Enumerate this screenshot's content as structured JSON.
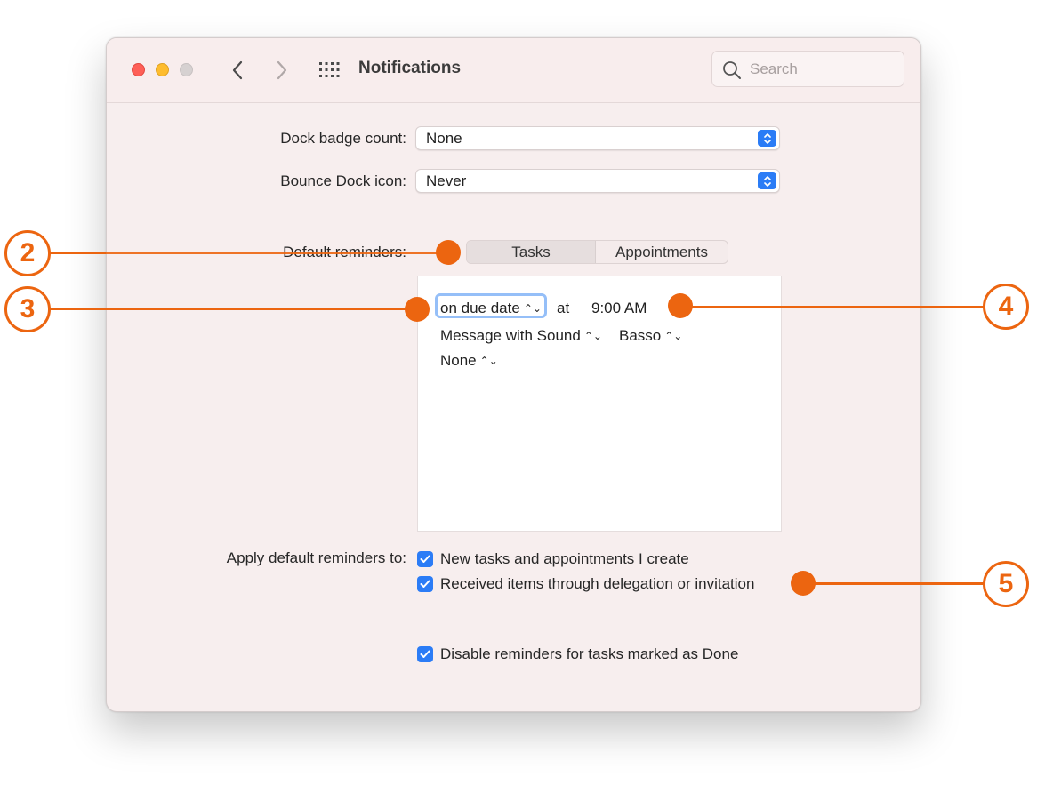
{
  "window": {
    "title": "Notifications",
    "search_placeholder": "Search"
  },
  "dock_badge": {
    "label": "Dock badge count:",
    "value": "None"
  },
  "bounce_dock": {
    "label": "Bounce Dock icon:",
    "value": "Never"
  },
  "default_reminders": {
    "label": "Default reminders:",
    "tabs": [
      "Tasks",
      "Appointments"
    ],
    "selected_tab": "Tasks",
    "when": "on due date",
    "at_label": "at",
    "time": "9:00 AM",
    "alert_type": "Message with Sound",
    "sound": "Basso",
    "extra": "None"
  },
  "apply_to": {
    "label": "Apply default reminders to:",
    "options": [
      {
        "label": "New tasks and appointments I create",
        "checked": true
      },
      {
        "label": "Received items through delegation or invitation",
        "checked": true
      }
    ]
  },
  "disable_done": {
    "label": "Disable reminders for tasks marked as Done",
    "checked": true
  },
  "callouts": [
    "2",
    "3",
    "4",
    "5"
  ],
  "colors": {
    "accent": "#2b7cf6",
    "callout": "#ec6510",
    "window_bg": "#f7eeee"
  }
}
